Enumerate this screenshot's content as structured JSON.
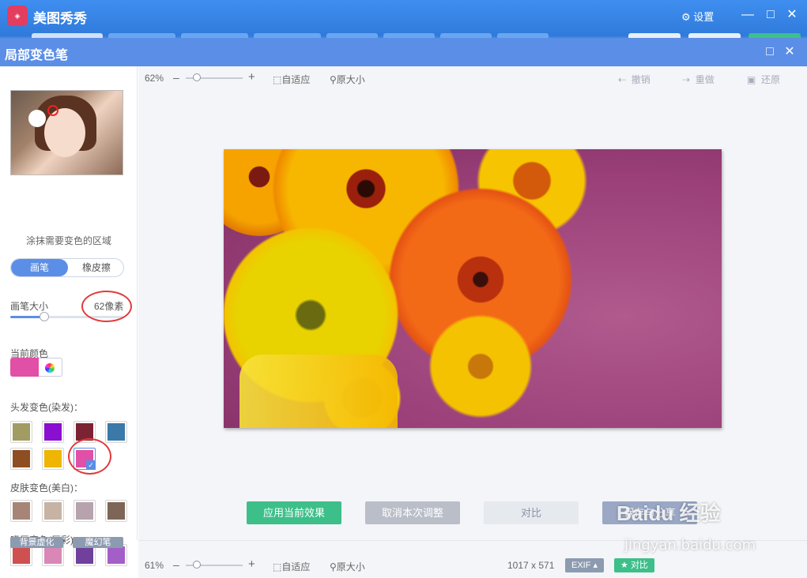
{
  "app": {
    "title": "美图秀秀",
    "settings_label": "设置",
    "logo_text": "meitu"
  },
  "dialog": {
    "title": "局部变色笔"
  },
  "sidebar": {
    "hint": "涂抹需要变色的区域",
    "mode_tabs": [
      "画笔",
      "橡皮擦"
    ],
    "brush_size_label": "画笔大小",
    "brush_size_value": "62像素",
    "brush_size_fraction": 0.3,
    "current_color_label": "当前颜色",
    "current_color": "#e14fa6",
    "hair_label": "头发变色(染发)：",
    "hair_colors": [
      "#a19c63",
      "#8a0fd0",
      "#7b2233",
      "#3a79a8",
      "#8e4e22",
      "#f0b500",
      "#e14fa6"
    ],
    "skin_label": "皮肤变色(美白)：",
    "skin_colors": [
      "#a68577",
      "#c6b3a3",
      "#b6a3ad",
      "#7d6656"
    ],
    "lip_label": "嘴唇变色(唇彩)：",
    "lip_colors": [
      "#cf5050",
      "#d987b6",
      "#70409c",
      "#a45ec8"
    ],
    "bottom_tags": [
      "背景虚化",
      "魔幻笔"
    ]
  },
  "toolbar": {
    "zoom": "62%",
    "fit_label": "自适应",
    "original_label": "原大小",
    "undo_label": "撤销",
    "redo_label": "重做",
    "restore_label": "还原",
    "zoom_fraction": 0.2
  },
  "actions": {
    "apply": "应用当前效果",
    "cancel": "取消本次调整",
    "compare": "对比",
    "save_share": "保存与分享"
  },
  "status": {
    "zoom": "61%",
    "fit_label": "自适应",
    "original_label": "原大小",
    "dimensions": "1017 x 571",
    "exif": "EXIF",
    "compare": "对比",
    "zoom_fraction": 0.2
  },
  "watermark": {
    "brand": "Baidu 经验",
    "url": "jingyan.baidu.com"
  },
  "colors": {
    "accent": "#5b8ee6",
    "apply": "#3dbf8a",
    "cancel": "#b9bec8",
    "compare_bg": "#e6e9ee"
  }
}
